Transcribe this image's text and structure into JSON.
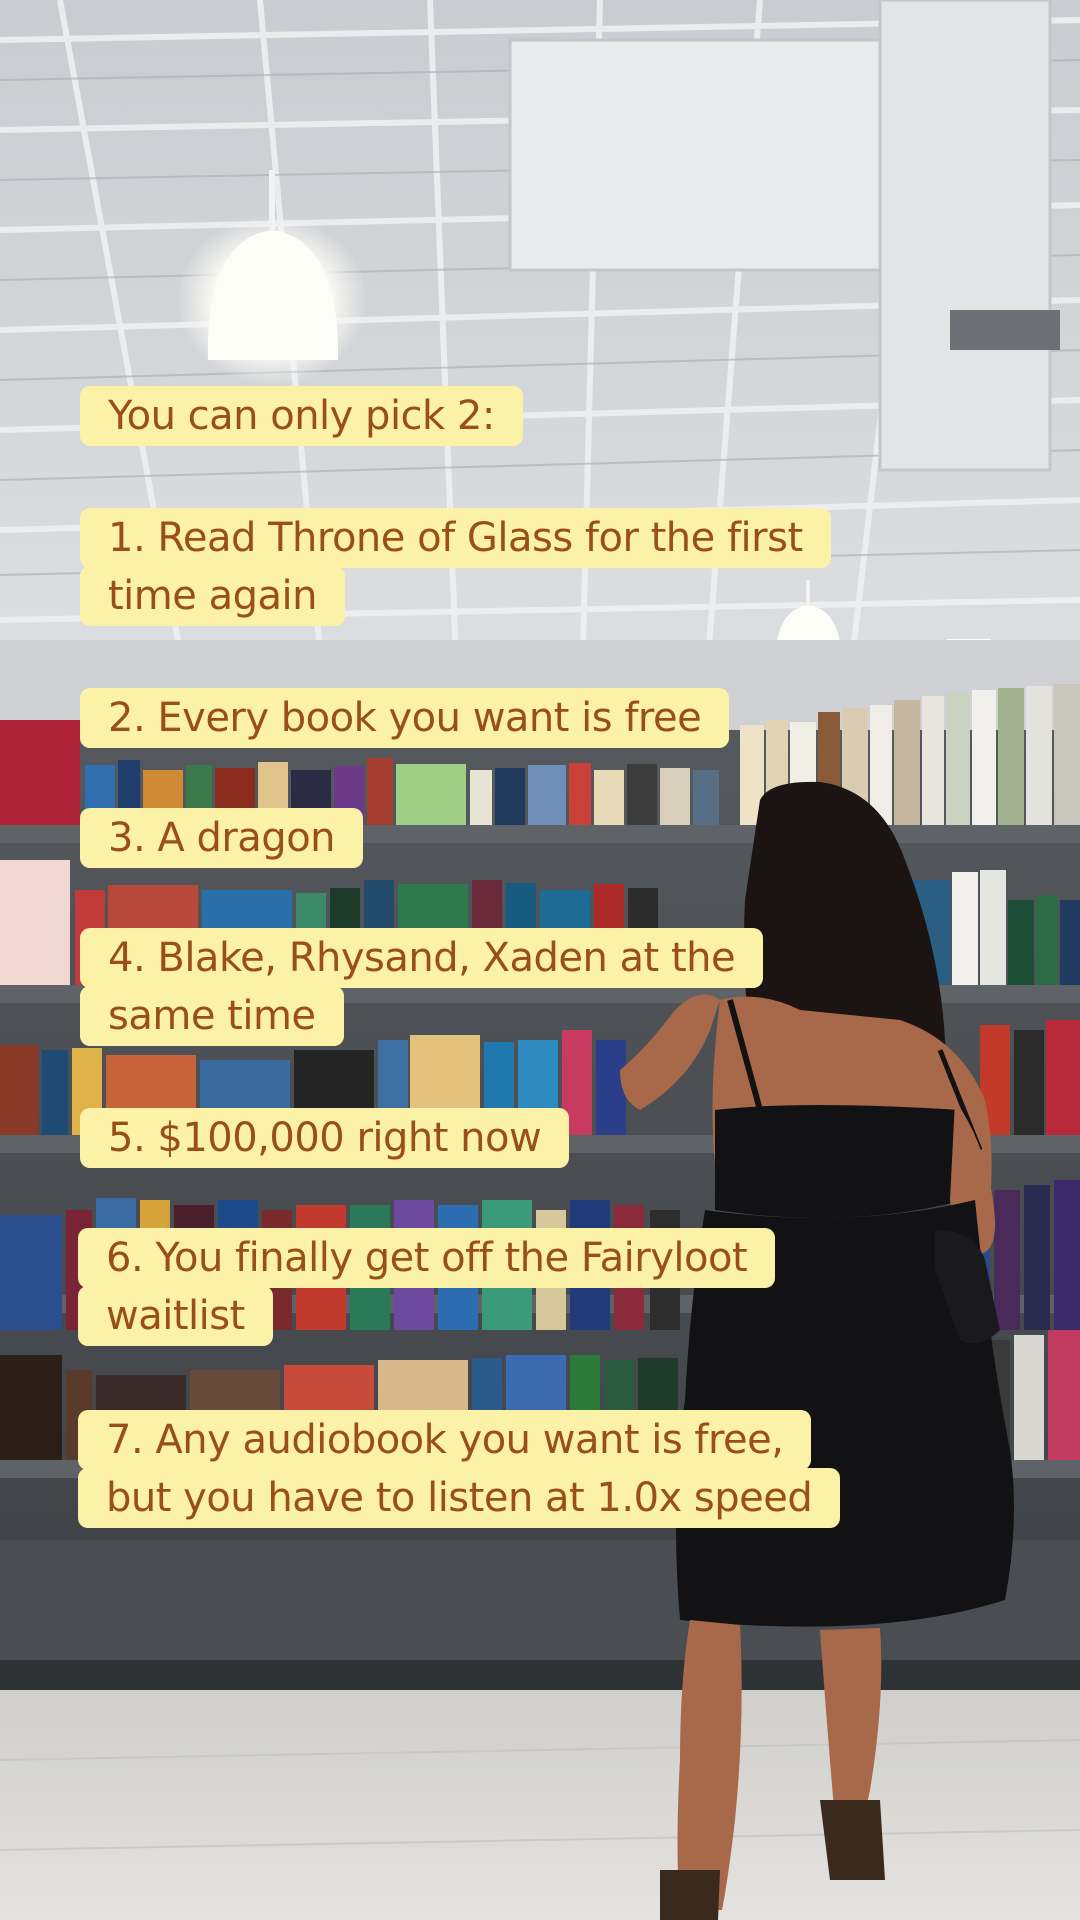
{
  "caption": {
    "intro": "You can only pick 2:",
    "options": [
      {
        "lines": [
          "1. Read Throne of Glass for the first",
          "time again"
        ]
      },
      {
        "lines": [
          "2. Every book you want is free"
        ]
      },
      {
        "lines": [
          "3. A dragon"
        ]
      },
      {
        "lines": [
          "4. Blake, Rhysand, Xaden at the",
          "same time"
        ]
      },
      {
        "lines": [
          "5. $100,000 right now"
        ]
      },
      {
        "lines": [
          "6. You finally get off the Fairyloot",
          "waitlist"
        ]
      },
      {
        "lines": [
          "7. Any audiobook you want is free,",
          "but you have to listen at 1.0x speed"
        ]
      }
    ]
  },
  "colors": {
    "caption_bg": "#fbf2a8",
    "caption_text": "#9a4f17",
    "ceiling": "#d6d8db",
    "shelf": "#4c5054",
    "floor": "#d9d8d4",
    "dress": "#121214",
    "skin": "#a8694a",
    "hair": "#1b1412"
  },
  "scene": {
    "exit_sign_glyph": "⮕"
  }
}
